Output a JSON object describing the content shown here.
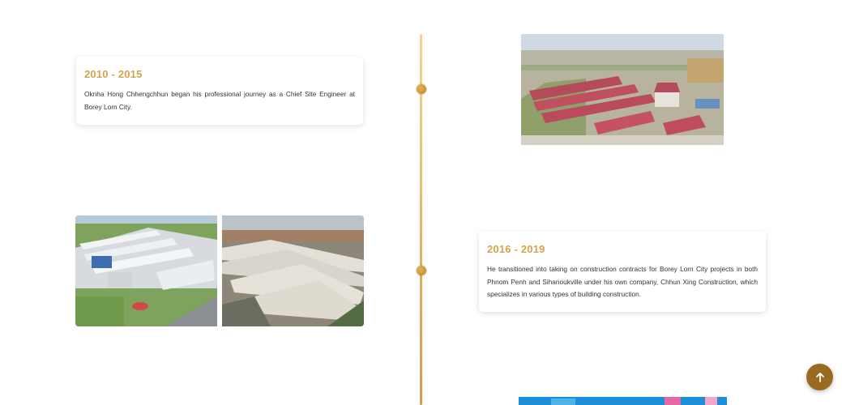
{
  "timeline": {
    "items": [
      {
        "years": "2010 - 2015",
        "description": "Oknha Hong Chhengchhun began his professional journey as a Chief Site Engineer at Borey Lorn City."
      },
      {
        "years": "2016 - 2019",
        "description": "He transitioned into taking on construction contracts for Borey Lorn City projects in both Phnom Penh and Sihanoukville under his own company, Chhun Xing Construction, which specializes in various types of building construction."
      }
    ]
  },
  "colors": {
    "accent_gold": "#d6a34f",
    "scroll_button": "#9a6a20"
  },
  "icons": {
    "scroll_top": "arrow-up-icon"
  }
}
